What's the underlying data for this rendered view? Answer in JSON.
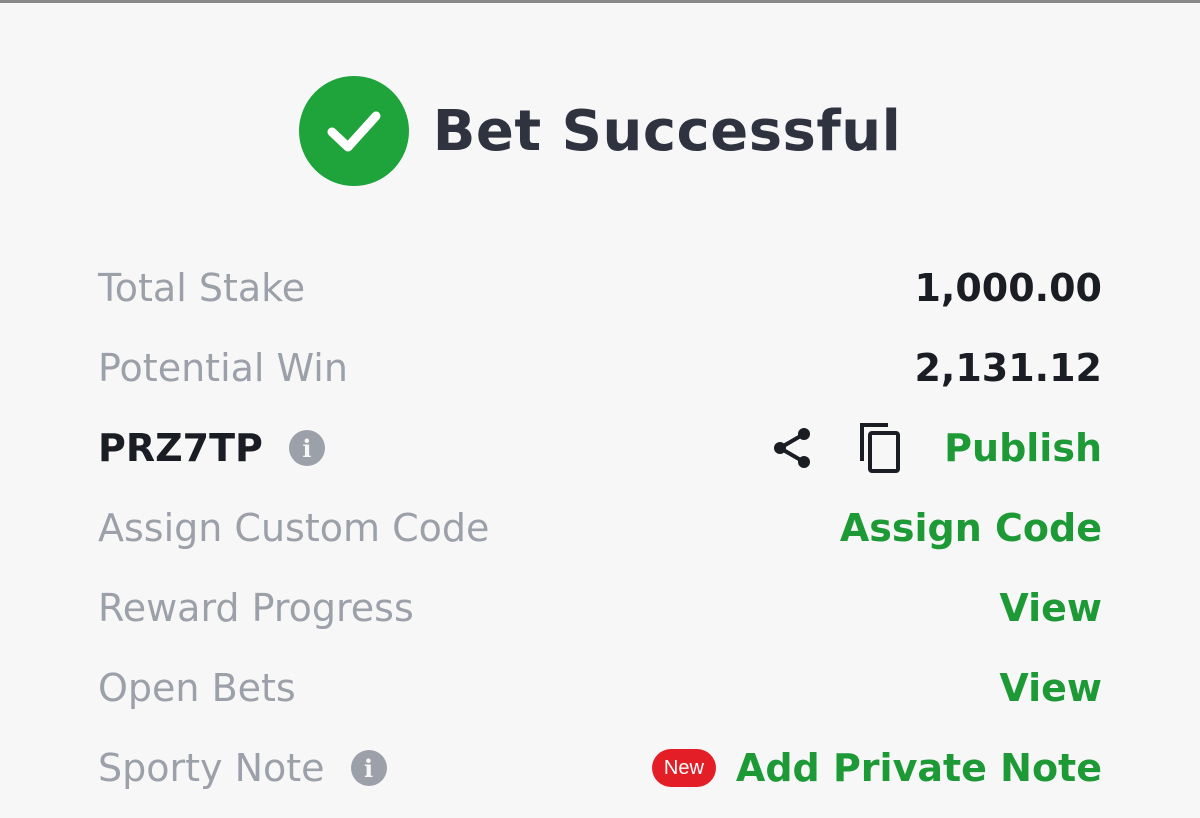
{
  "header": {
    "title": "Bet Successful",
    "icon": "check-circle-icon",
    "accent_color": "#1fa33b"
  },
  "summary": {
    "total_stake": {
      "label": "Total Stake",
      "value": "1,000.00"
    },
    "potential_win": {
      "label": "Potential Win",
      "value": "2,131.12"
    }
  },
  "booking": {
    "code": "PRZ7TP",
    "info_icon": "info-icon",
    "share_icon": "share-icon",
    "copy_icon": "copy-icon",
    "publish_label": "Publish"
  },
  "custom_code": {
    "label": "Assign Custom Code",
    "action": "Assign Code"
  },
  "reward_progress": {
    "label": "Reward Progress",
    "action": "View"
  },
  "open_bets": {
    "label": "Open Bets",
    "action": "View"
  },
  "sporty_note": {
    "label": "Sporty Note",
    "info_icon": "info-icon",
    "badge": "New",
    "action": "Add Private Note"
  },
  "colors": {
    "link_green": "#1d9a36",
    "badge_red": "#e41e26",
    "muted_text": "#9ca0a9"
  }
}
